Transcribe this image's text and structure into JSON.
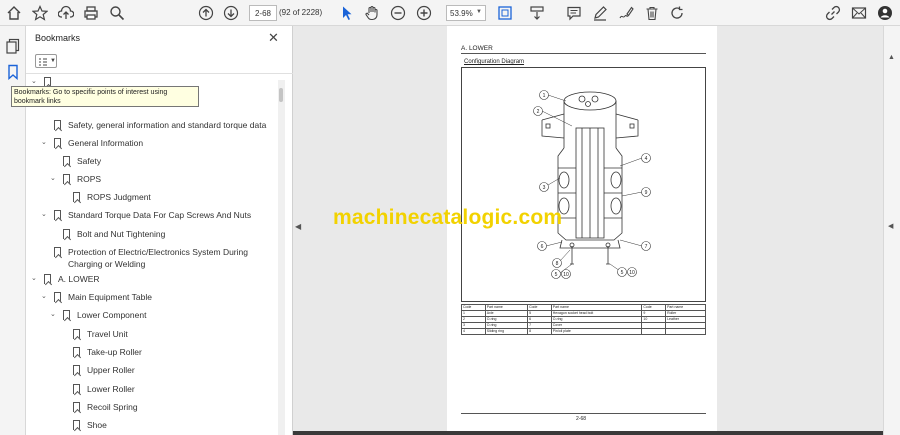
{
  "toolbar": {
    "page_current": "2-68",
    "page_of": "(92 of 2228)",
    "zoom": "53.9%",
    "icons": [
      "home-icon",
      "star-icon",
      "upload-icon",
      "print-icon",
      "search-icon",
      "up-icon",
      "down-icon",
      "select-icon",
      "hand-icon",
      "zoom-out-icon",
      "zoom-in-icon",
      "fit-icon",
      "scroll-icon",
      "comment-icon",
      "pen-icon",
      "sign-icon",
      "delete-icon",
      "rotate-icon",
      "share-link-icon",
      "mail-icon",
      "account-icon"
    ]
  },
  "bookmarks_panel": {
    "title": "Bookmarks",
    "tooltip": "Bookmarks: Go to specific points of interest using bookmark links",
    "items": [
      {
        "label": "Safety, general information and standard torque data"
      },
      {
        "label": "General Information"
      },
      {
        "label": "Safety"
      },
      {
        "label": "ROPS"
      },
      {
        "label": "ROPS Judgment"
      },
      {
        "label": "Standard Torque Data For Cap Screws And Nuts"
      },
      {
        "label": "Bolt and Nut Tightening"
      },
      {
        "label": "Protection of Electric/Electronics System During"
      },
      {
        "label": "Charging or Welding"
      },
      {
        "label": "A. LOWER"
      },
      {
        "label": "Main Equipment Table"
      },
      {
        "label": "Lower Component"
      },
      {
        "label": "Travel Unit"
      },
      {
        "label": "Take-up Roller"
      },
      {
        "label": "Upper Roller"
      },
      {
        "label": "Lower Roller"
      },
      {
        "label": "Recoil Spring"
      },
      {
        "label": "Shoe"
      }
    ]
  },
  "document": {
    "heading": "A. LOWER",
    "subheading": "Configuration Diagram",
    "watermark": "machinecatalogic.com",
    "page_number": "2-68",
    "table_rows": [
      [
        "Code",
        "Part name",
        "Code",
        "Part name",
        "Code",
        "Part name"
      ],
      [
        "1",
        "Axle",
        "5",
        "Hexagon socket head bolt",
        "9",
        "Roller"
      ],
      [
        "2",
        "O-ring",
        "6",
        "O-ring",
        "10",
        "Leather"
      ],
      [
        "3",
        "O-ring",
        "7",
        "Cover",
        "",
        ""
      ],
      [
        "4",
        "Sliding ring",
        "8",
        "Pin/oil plate",
        "",
        ""
      ]
    ]
  }
}
